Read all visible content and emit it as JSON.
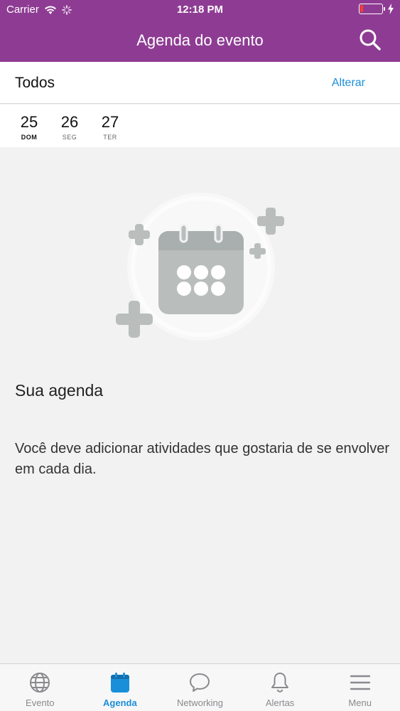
{
  "status_bar": {
    "carrier": "Carrier",
    "time": "12:18 PM",
    "battery_level": 0.15
  },
  "header": {
    "title": "Agenda do evento"
  },
  "filter": {
    "label": "Todos",
    "action": "Alterar"
  },
  "dates": [
    {
      "num": "25",
      "day": "DOM",
      "active": true
    },
    {
      "num": "26",
      "day": "SEG",
      "active": false
    },
    {
      "num": "27",
      "day": "TER",
      "active": false
    }
  ],
  "empty": {
    "title": "Sua agenda",
    "text": "Você deve adicionar atividades que gostaria de se envolver em cada dia."
  },
  "tabs": [
    {
      "label": "Evento",
      "icon": "globe-icon",
      "active": false
    },
    {
      "label": "Agenda",
      "icon": "calendar-icon",
      "active": true
    },
    {
      "label": "Networking",
      "icon": "chat-bubble-icon",
      "active": false
    },
    {
      "label": "Alertas",
      "icon": "bell-icon",
      "active": false
    },
    {
      "label": "Menu",
      "icon": "hamburger-menu-icon",
      "active": false
    }
  ],
  "colors": {
    "brand": "#8e3c93",
    "accent": "#1a8fd9",
    "illustration": "#b9bebd"
  }
}
